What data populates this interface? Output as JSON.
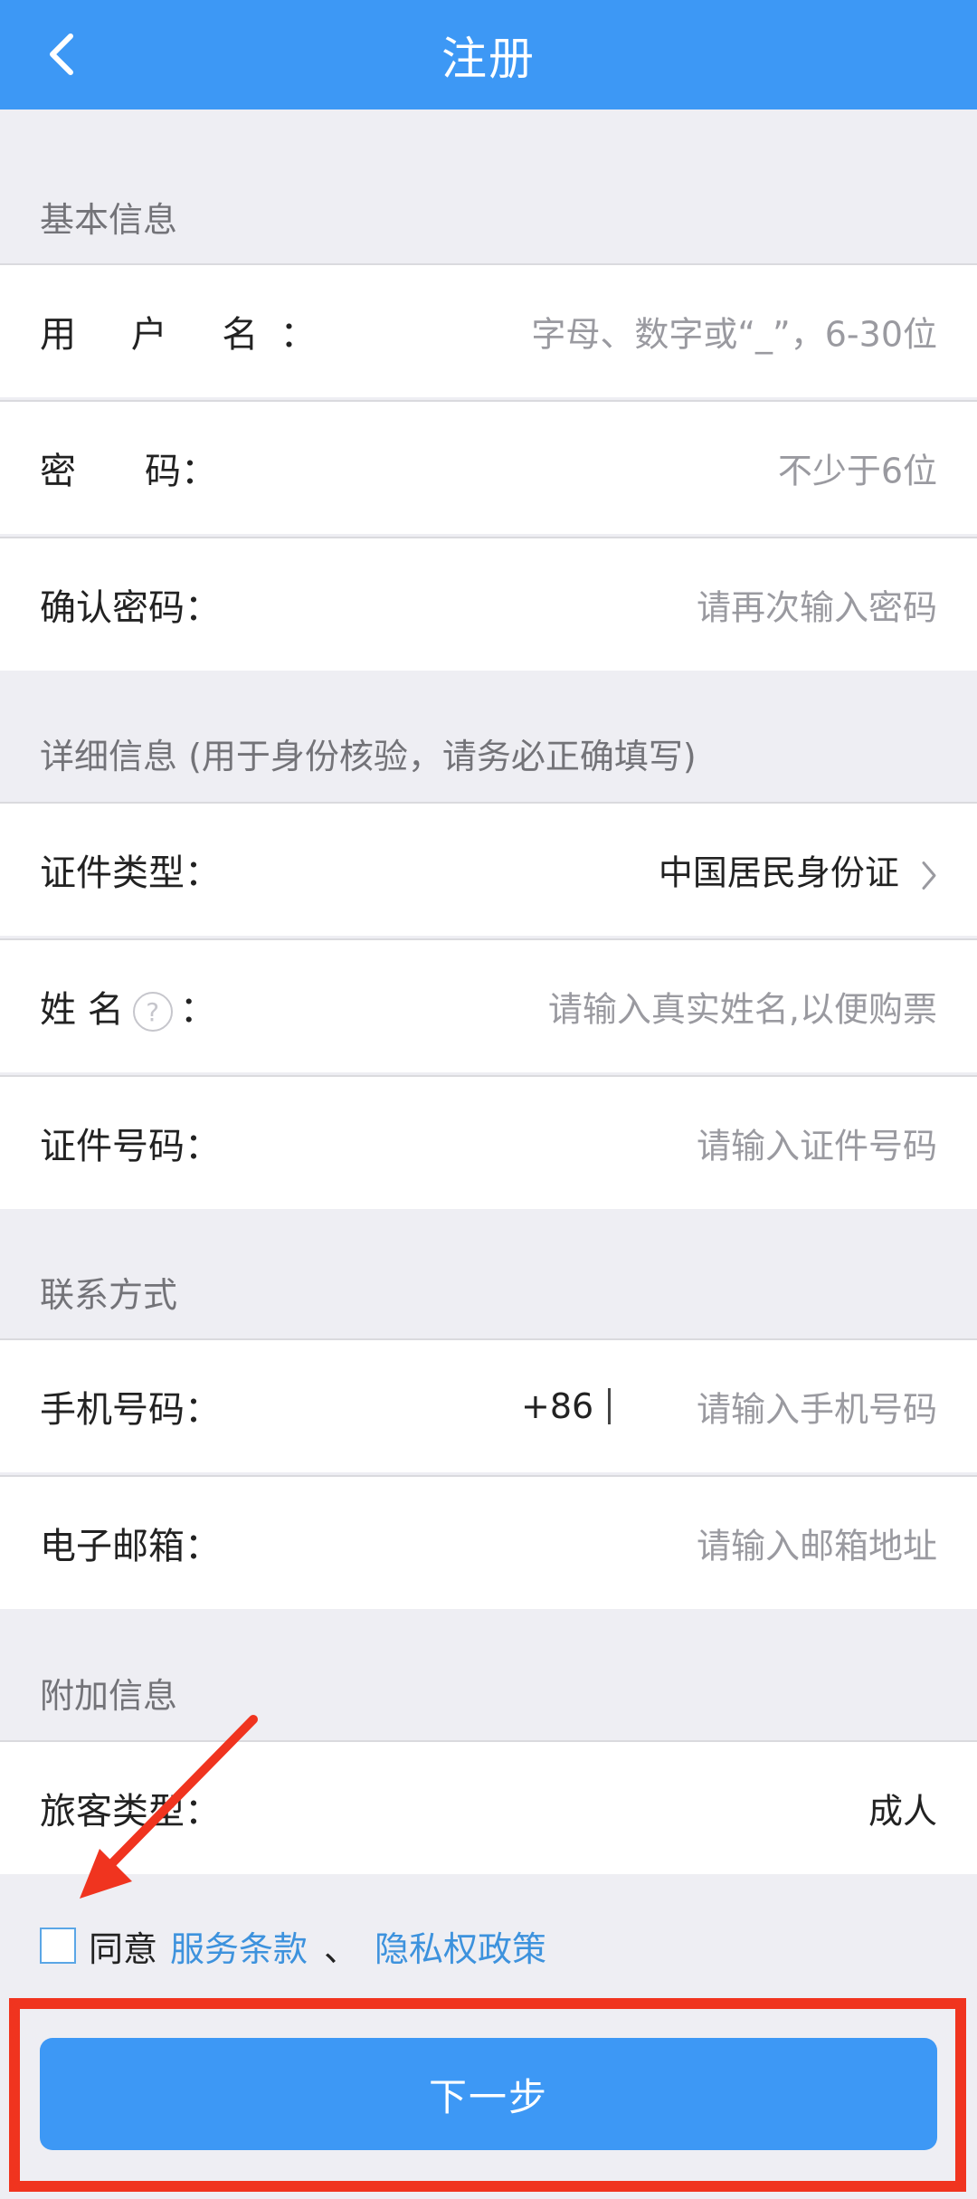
{
  "header": {
    "title": "注册"
  },
  "sections": {
    "basic": "基本信息",
    "detail": "详细信息 (用于身份核验，请务必正确填写)",
    "contact": "联系方式",
    "extra": "附加信息"
  },
  "fields": {
    "username": {
      "label": "用 户 名",
      "placeholder": "字母、数字或“_”，6-30位"
    },
    "password": {
      "label_a": "密",
      "label_b": "码：",
      "placeholder": "不少于6位"
    },
    "confirm": {
      "label": "确认密码：",
      "placeholder": "请再次输入密码"
    },
    "id_type": {
      "label": "证件类型：",
      "value": "中国居民身份证"
    },
    "name": {
      "label": "姓 名",
      "help": "?",
      "colon": "：",
      "placeholder": "请输入真实姓名,以便购票"
    },
    "id_number": {
      "label": "证件号码：",
      "placeholder": "请输入证件号码"
    },
    "phone": {
      "label": "手机号码：",
      "prefix": "+86",
      "placeholder": "请输入手机号码"
    },
    "email": {
      "label": "电子邮箱：",
      "placeholder": "请输入邮箱地址"
    },
    "passenger_type": {
      "label": "旅客类型：",
      "value": "成人"
    }
  },
  "agreement": {
    "prefix": "同意",
    "terms": "服务条款",
    "separator": "、",
    "privacy": "隐私权政策"
  },
  "next_button": "下一步",
  "colors": {
    "brand_blue": "#3d98f5",
    "link_blue": "#3d92dd",
    "annotation_red": "#f0341f"
  }
}
